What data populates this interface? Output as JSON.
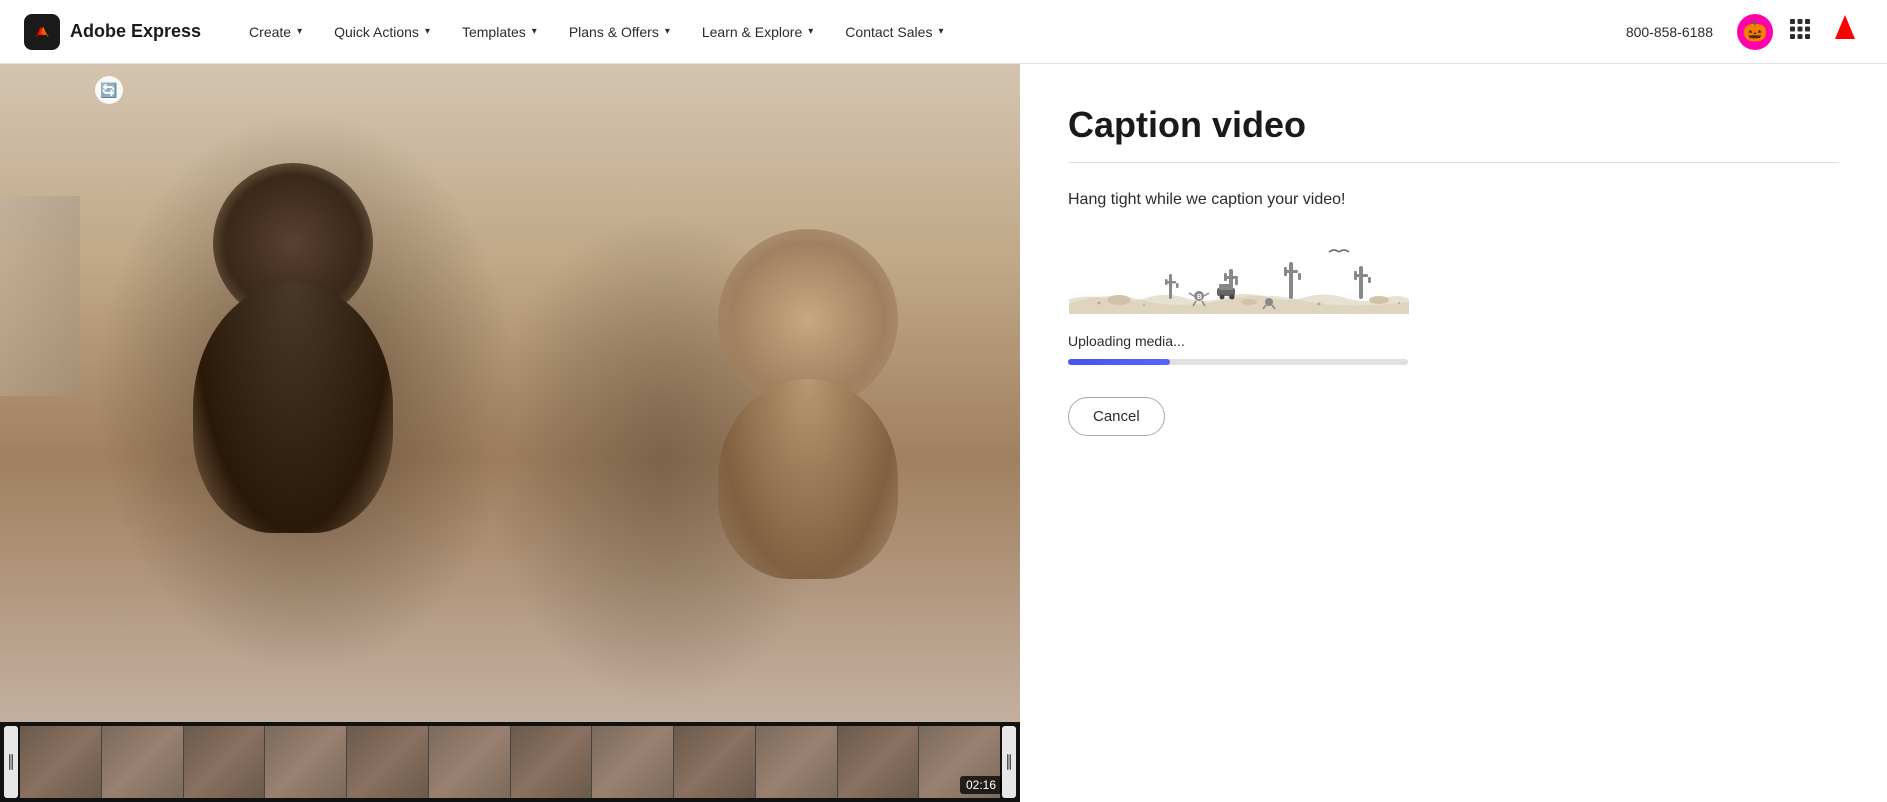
{
  "nav": {
    "logo_text": "Adobe Express",
    "items": [
      {
        "label": "Create",
        "has_chevron": true
      },
      {
        "label": "Quick Actions",
        "has_chevron": true
      },
      {
        "label": "Templates",
        "has_chevron": true
      },
      {
        "label": "Plans & Offers",
        "has_chevron": true
      },
      {
        "label": "Learn & Explore",
        "has_chevron": true
      },
      {
        "label": "Contact Sales",
        "has_chevron": true
      }
    ],
    "phone": "800-858-6188"
  },
  "video": {
    "top_icon": "🔄",
    "time_badge": "02:16"
  },
  "right_panel": {
    "title": "Caption video",
    "subtitle": "Hang tight while we caption your video!",
    "progress_label": "Uploading media...",
    "progress_percent": 30,
    "cancel_label": "Cancel"
  }
}
